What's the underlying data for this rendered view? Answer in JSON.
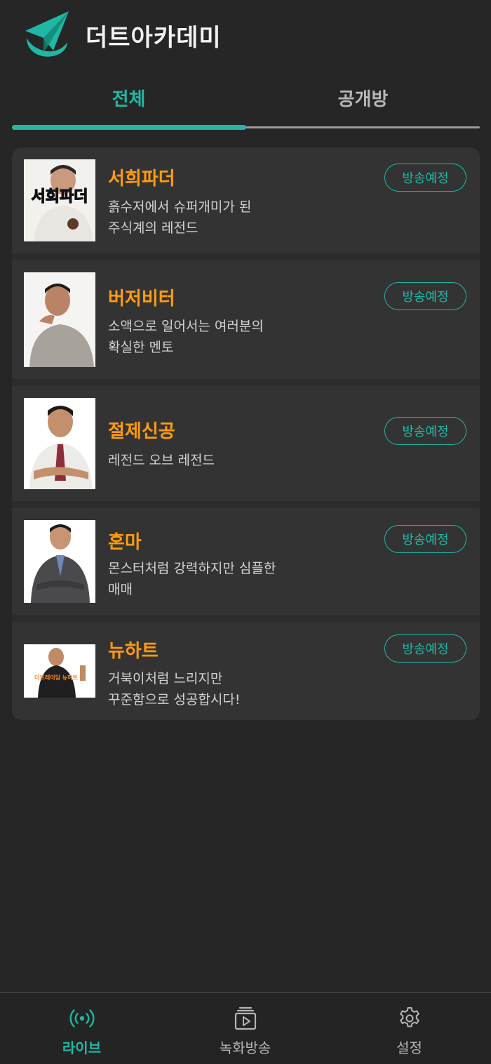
{
  "header": {
    "title": "더트아카데미",
    "logo_icon": "paper-plane-logo",
    "accent_color": "#1fb8a4"
  },
  "tabs": {
    "active_index": 0,
    "items": [
      {
        "label": "전체"
      },
      {
        "label": "공개방"
      }
    ]
  },
  "streamers": [
    {
      "name": "서희파더",
      "desc_lines": [
        "흙수저에서 슈퍼개미가 된",
        "주식계의 레전드"
      ],
      "status": "방송예정",
      "avatar_text": "서희파더"
    },
    {
      "name": "버저비터",
      "desc_lines": [
        "소액으로 일어서는 여러분의",
        "확실한 멘토"
      ],
      "status": "방송예정"
    },
    {
      "name": "절제신공",
      "desc_lines": [
        "레전드 오브 레전드"
      ],
      "status": "방송예정"
    },
    {
      "name": "혼마",
      "desc_lines": [
        "몬스터처럼 강력하지만 심플한",
        "매매"
      ],
      "status": "방송예정"
    },
    {
      "name": "뉴하트",
      "desc_lines": [
        "거북이처럼 느리지만",
        "꾸준함으로 성공합시다!"
      ],
      "status": "방송예정",
      "avatar_text": "더트레이딩 뉴하트"
    }
  ],
  "bottom_nav": {
    "active_index": 0,
    "items": [
      {
        "label": "라이브",
        "icon": "broadcast-icon"
      },
      {
        "label": "녹화방송",
        "icon": "video-library-icon"
      },
      {
        "label": "설정",
        "icon": "gear-icon"
      }
    ]
  },
  "colors": {
    "background": "#262626",
    "card": "#333333",
    "name": "#ff9b0f",
    "accent": "#1fb8a4"
  }
}
